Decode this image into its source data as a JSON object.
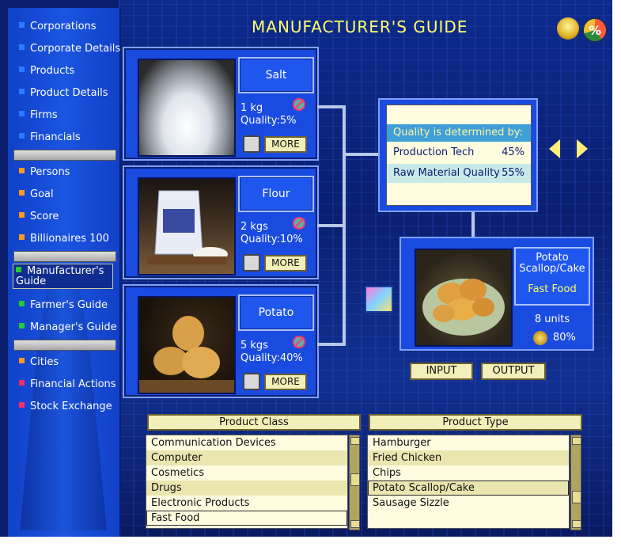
{
  "title": "MANUFACTURER'S GUIDE",
  "sidebar": {
    "items": [
      {
        "label": "Corporations",
        "color": "#2a7bff"
      },
      {
        "label": "Corporate Details",
        "color": "#2a7bff"
      },
      {
        "label": "Products",
        "color": "#2a7bff"
      },
      {
        "label": "Product Details",
        "color": "#2a7bff"
      },
      {
        "label": "Firms",
        "color": "#2a7bff"
      },
      {
        "label": "Financials",
        "color": "#2a7bff"
      },
      {
        "label": "Persons",
        "color": "#ff9a1a"
      },
      {
        "label": "Goal",
        "color": "#ff9a1a"
      },
      {
        "label": "Score",
        "color": "#ff9a1a"
      },
      {
        "label": "Billionaires 100",
        "color": "#ff9a1a"
      },
      {
        "label": "Manufacturer's Guide",
        "color": "#22cc33"
      },
      {
        "label": "Farmer's Guide",
        "color": "#22cc33"
      },
      {
        "label": "Manager's Guide",
        "color": "#22cc33"
      },
      {
        "label": "Cities",
        "color": "#ff9a1a"
      },
      {
        "label": "Financial Actions",
        "color": "#ff2a6a"
      },
      {
        "label": "Stock Exchange",
        "color": "#ff2a6a"
      }
    ]
  },
  "inputs": [
    {
      "name": "Salt",
      "qty": "1 kg",
      "quality": "Quality:5%",
      "more": "MORE",
      "image": "salt-pile"
    },
    {
      "name": "Flour",
      "qty": "2 kgs",
      "quality": "Quality:10%",
      "more": "MORE",
      "image": "flour-bag"
    },
    {
      "name": "Potato",
      "qty": "5 kgs",
      "quality": "Quality:40%",
      "more": "MORE",
      "image": "potatoes"
    }
  ],
  "quality_info": {
    "header": "Quality is determined by:",
    "rows": [
      {
        "label": "Production Tech",
        "value": "45%"
      },
      {
        "label": "Raw Material Quality",
        "value": "55%"
      }
    ]
  },
  "output": {
    "name_line1": "Potato",
    "name_line2": "Scallop/Cake",
    "category": "Fast Food",
    "units": "8 units",
    "pct": "80%"
  },
  "buttons": {
    "input": "INPUT",
    "output": "OUTPUT"
  },
  "product_class": {
    "header": "Product Class",
    "items": [
      "Communication Devices",
      "Computer",
      "Cosmetics",
      "Drugs",
      "Electronic Products",
      "Fast Food"
    ],
    "selected": "Fast Food"
  },
  "product_type": {
    "header": "Product Type",
    "items": [
      "Hamburger",
      "Fried Chicken",
      "Chips",
      "Potato Scallop/Cake",
      "Sausage Sizzle"
    ],
    "selected": "Potato Scallop/Cake"
  },
  "icons": {
    "bulb": "lightbulb-icon",
    "percent": "percent-icon"
  }
}
